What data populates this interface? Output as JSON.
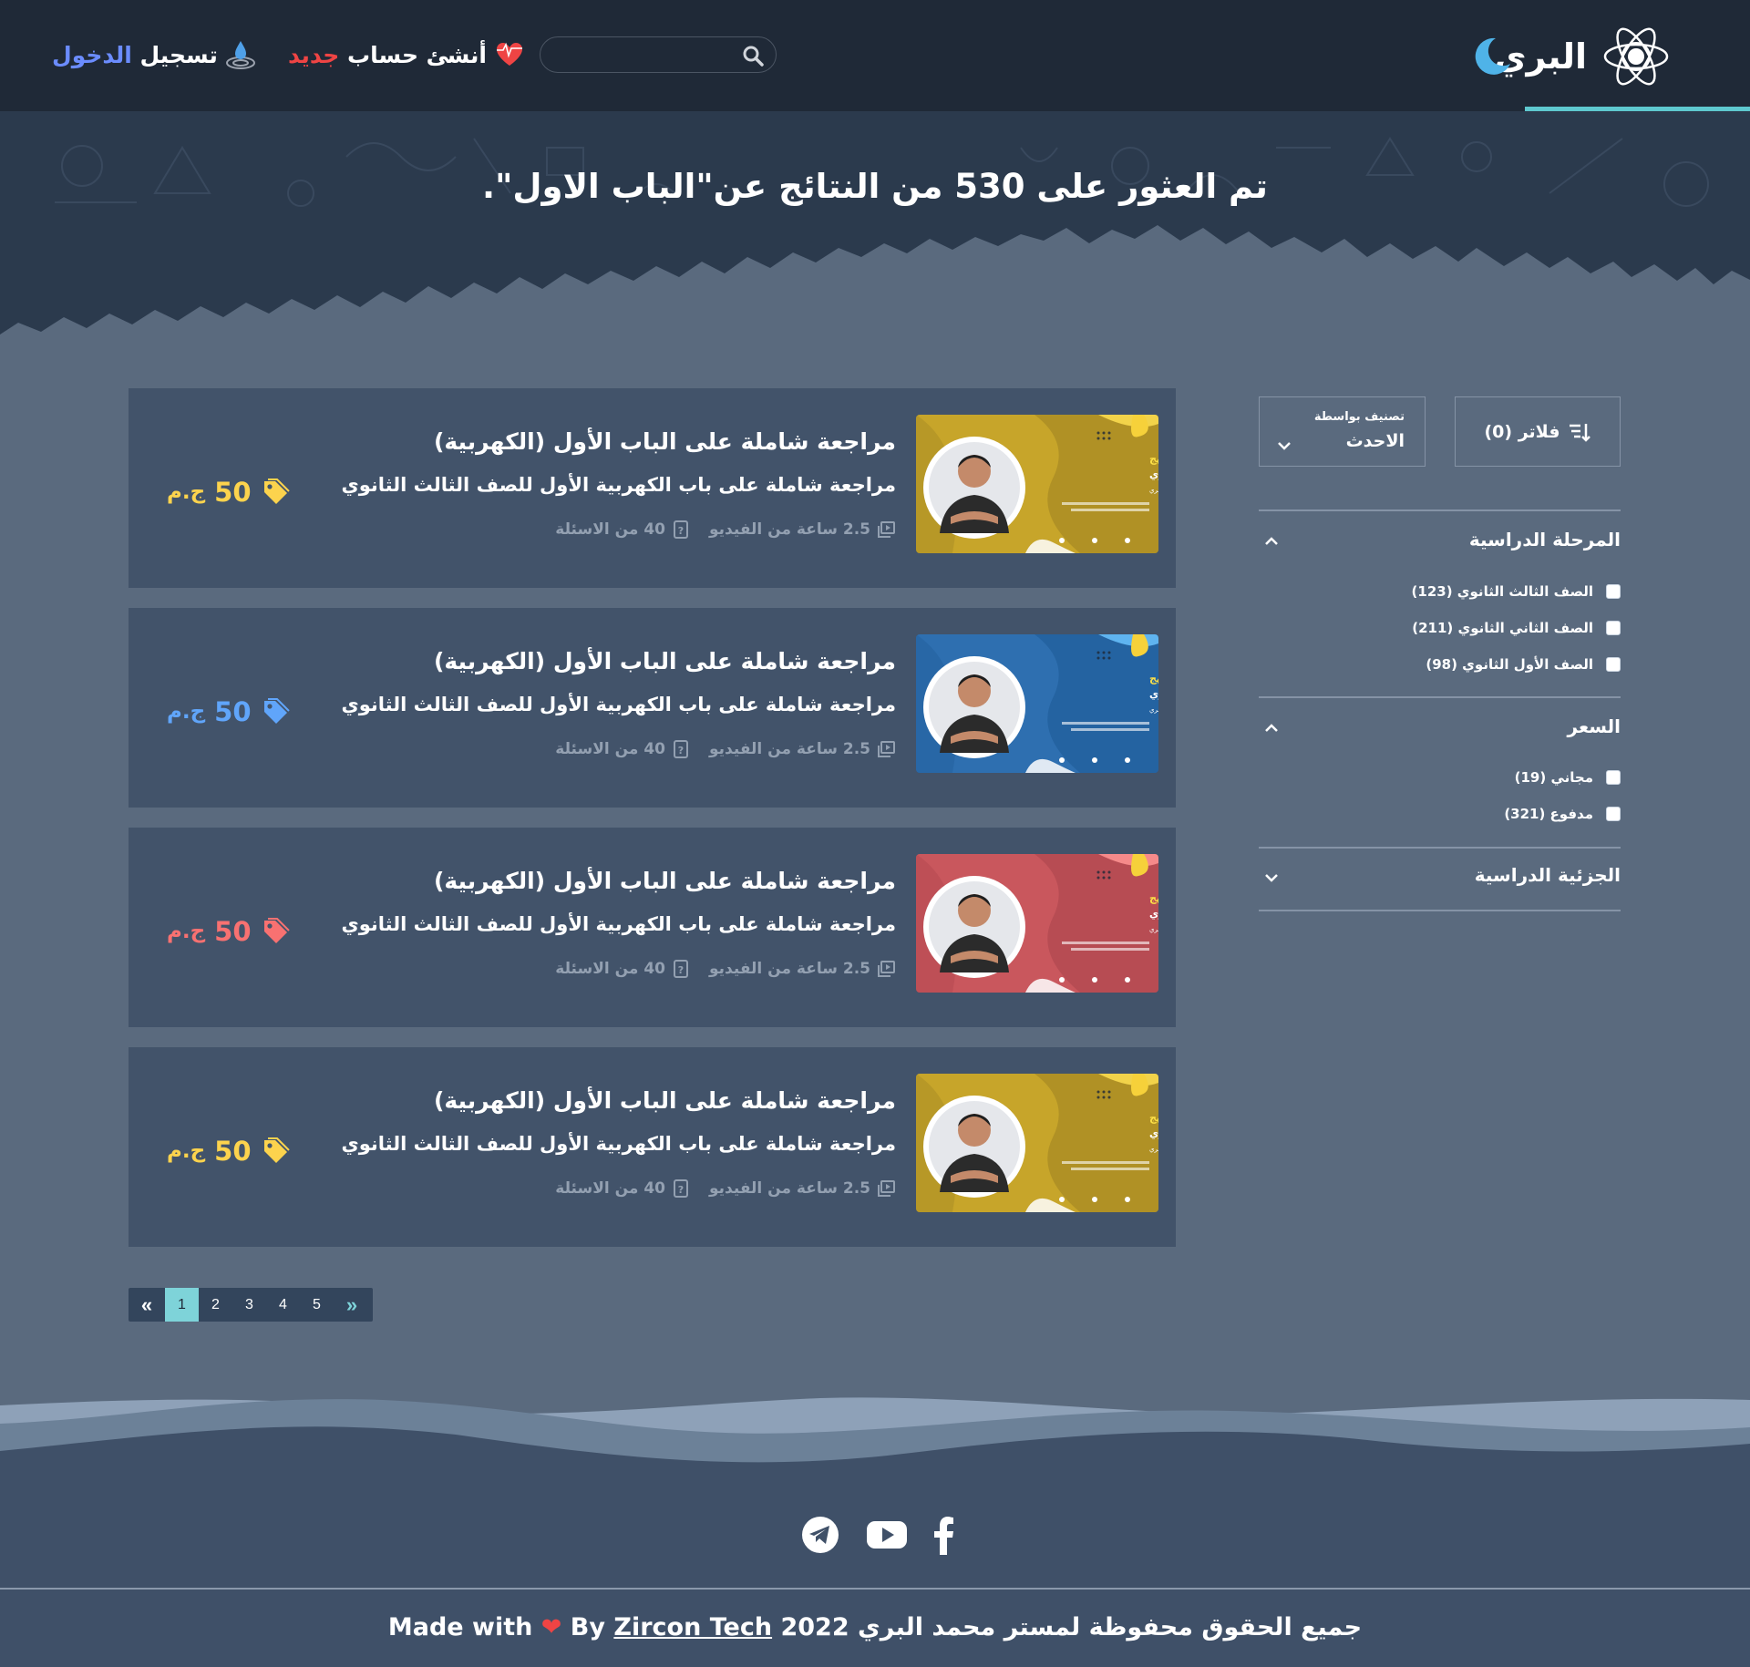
{
  "header": {
    "brand_name": "البري",
    "search_placeholder": "",
    "signup_part1": "أنشئ حساب ",
    "signup_part2": "جديد",
    "login_part1": "تسجيل ",
    "login_part2": "الدخول"
  },
  "hero": {
    "results_text": "تم العثور على 530 من النتائج عن\"الباب الاول\"."
  },
  "courses": [
    {
      "title": "مراجعة شاملة على الباب الأول (الكهربية)",
      "subtitle": "مراجعة شاملة على باب الكهربية الأول للصف الثالث الثانوي",
      "hours": "2.5 ساعة من الفيديو",
      "questions": "40 من الاسئلة",
      "price": "50",
      "currency": "ج.م",
      "accent": "#fcd34d",
      "theme": "yellow",
      "thumb_bg": "#c7a52a",
      "thumb_title": "مراجعة شاملة على المنهج",
      "thumb_grade": "للصف الثالث الثانوي",
      "thumb_teacher": "أ. محمد البري"
    },
    {
      "title": "مراجعة شاملة على الباب الأول (الكهربية)",
      "subtitle": "مراجعة شاملة على باب الكهربية الأول للصف الثالث الثانوي",
      "hours": "2.5 ساعة من الفيديو",
      "questions": "40 من الاسئلة",
      "price": "50",
      "currency": "ج.م",
      "accent": "#60a5fa",
      "theme": "blue",
      "thumb_bg": "#2e6fb0",
      "thumb_title": "مراجعة شاملة على المنهج",
      "thumb_grade": "للصف الثاني الثانوي",
      "thumb_teacher": "أ. محمد البري"
    },
    {
      "title": "مراجعة شاملة على الباب الأول (الكهربية)",
      "subtitle": "مراجعة شاملة على باب الكهربية الأول للصف الثالث الثانوي",
      "hours": "2.5 ساعة من الفيديو",
      "questions": "40 من الاسئلة",
      "price": "50",
      "currency": "ج.م",
      "accent": "#f87171",
      "theme": "red",
      "thumb_bg": "#c9575d",
      "thumb_title": "مراجعة شاملة على المنهج",
      "thumb_grade": "للصف الأول الثانوي",
      "thumb_teacher": "أ. محمد البري"
    },
    {
      "title": "مراجعة شاملة على الباب الأول (الكهربية)",
      "subtitle": "مراجعة شاملة على باب الكهربية الأول للصف الثالث الثانوي",
      "hours": "2.5 ساعة من الفيديو",
      "questions": "40 من الاسئلة",
      "price": "50",
      "currency": "ج.م",
      "accent": "#fcd34d",
      "theme": "yellow",
      "thumb_bg": "#c7a52a",
      "thumb_title": "مراجعة شاملة على المنهج",
      "thumb_grade": "للصف الثالث الثانوي",
      "thumb_teacher": "أ. محمد البري"
    }
  ],
  "pagination": {
    "prev": "«",
    "pages": [
      "1",
      "2",
      "3",
      "4",
      "5"
    ],
    "active": "1",
    "next": "»"
  },
  "sidebar": {
    "sort_caption": "تصنيف بواسطة",
    "sort_value": "الاحدث",
    "filter_label": "فلاتر (0)",
    "sections": [
      {
        "title": "المرحلة الدراسية",
        "expanded": true,
        "options": [
          "الصف الثالث الثانوي (123)",
          "الصف الثاني الثانوي (211)",
          "الصف الأول الثانوي (98)"
        ]
      },
      {
        "title": "السعر",
        "expanded": true,
        "options": [
          "مجاني (19)",
          "مدفوع (321)"
        ]
      },
      {
        "title": "الجزئية الدراسية",
        "expanded": false,
        "options": []
      }
    ]
  },
  "footer": {
    "social": [
      "telegram-icon",
      "youtube-icon",
      "facebook-icon"
    ],
    "copyright_arabic": "جميع الحقوق محفوظة لمستر محمد البري 2022",
    "made_with": "Made with",
    "by": "By",
    "company": "Zircon Tech"
  },
  "colors": {
    "header_bg": "#1f2937",
    "page_bg": "#5a6a7e",
    "card_bg": "#42536a",
    "brand_accent": "#5ec8cf",
    "moon": "#4fb3e8"
  }
}
